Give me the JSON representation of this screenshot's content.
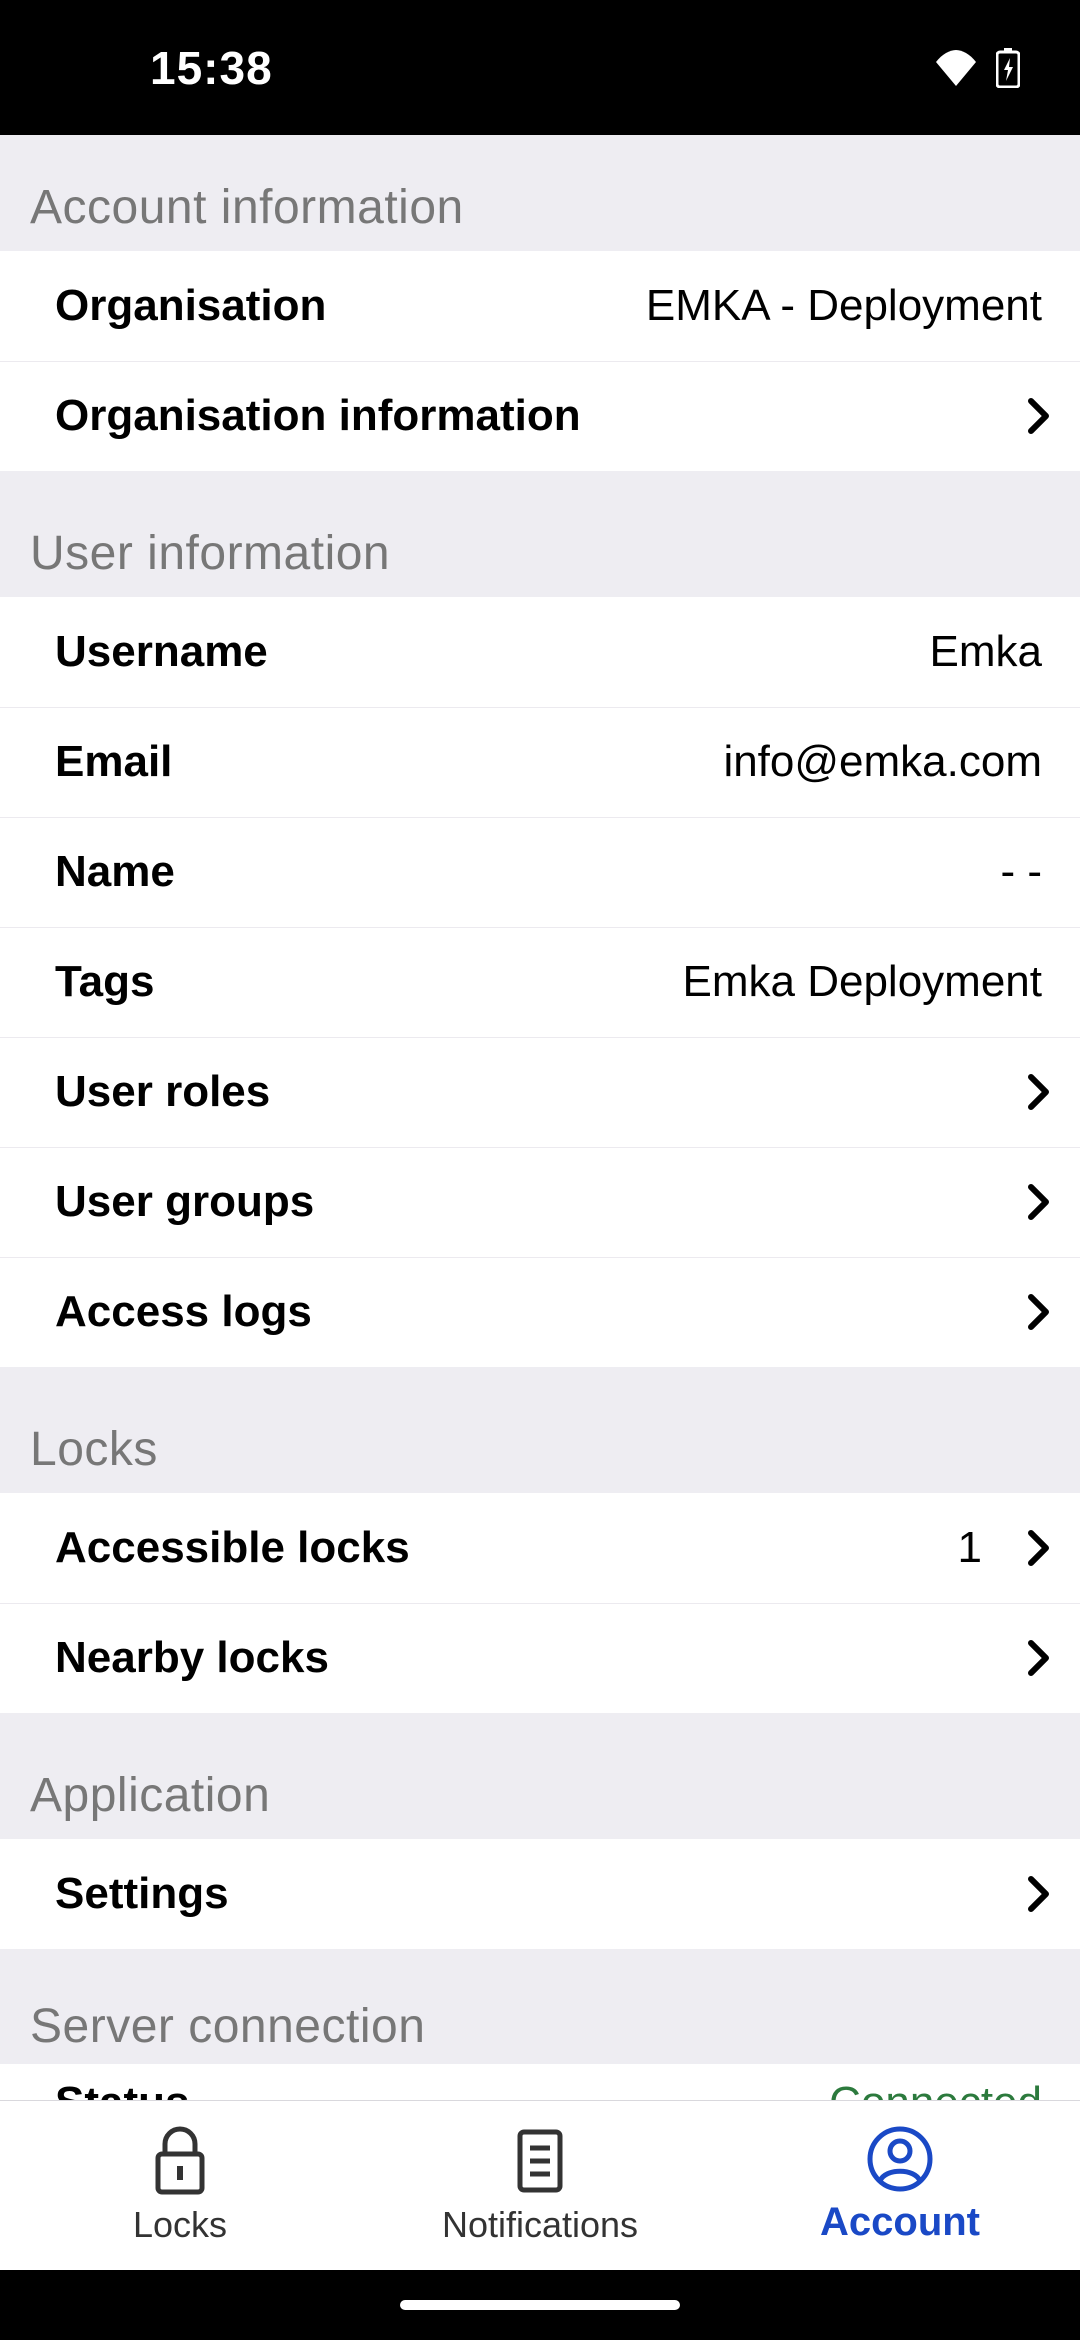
{
  "status_bar": {
    "time": "15:38"
  },
  "sections": {
    "account_info": {
      "title": "Account information",
      "organisation_label": "Organisation",
      "organisation_value": "EMKA - Deployment",
      "org_info_label": "Organisation information"
    },
    "user_info": {
      "title": "User information",
      "username_label": "Username",
      "username_value": "Emka",
      "email_label": "Email",
      "email_value": "info@emka.com",
      "name_label": "Name",
      "name_value": "- -",
      "tags_label": "Tags",
      "tags_value": "Emka Deployment",
      "user_roles_label": "User roles",
      "user_groups_label": "User groups",
      "access_logs_label": "Access logs"
    },
    "locks": {
      "title": "Locks",
      "accessible_label": "Accessible locks",
      "accessible_value": "1",
      "nearby_label": "Nearby locks"
    },
    "application": {
      "title": "Application",
      "settings_label": "Settings"
    },
    "server": {
      "title": "Server connection",
      "status_label": "Status",
      "status_value": "Connected"
    }
  },
  "tabs": {
    "locks": "Locks",
    "notifications": "Notifications",
    "account": "Account"
  }
}
